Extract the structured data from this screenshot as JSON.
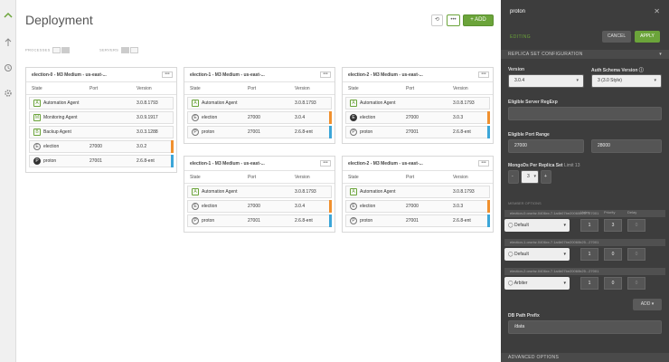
{
  "rail": {
    "items": [
      "deployment-icon",
      "server-icon",
      "clock-icon",
      "gear-icon"
    ]
  },
  "main": {
    "title": "Deployment",
    "add_label": "+ ADD",
    "processes_label": "PROCESSES",
    "servers_label": "SERVERS",
    "columns": [
      "State",
      "Port",
      "Version"
    ],
    "cards": [
      {
        "header": "election-0 - M3 Medium - us-east-...",
        "menu": "•••",
        "rows": [
          {
            "icon": "A",
            "icon_style": "green",
            "name": "Automation Agent",
            "port": "",
            "version": "3.0.8.1793",
            "marker": ""
          },
          {
            "icon": "M",
            "icon_style": "green",
            "name": "Monitoring Agent",
            "port": "",
            "version": "3.0.9.1917",
            "marker": ""
          },
          {
            "icon": "B",
            "icon_style": "green",
            "name": "Backup Agent",
            "port": "",
            "version": "3.0.3.1288",
            "marker": ""
          },
          {
            "icon": "E",
            "icon_style": "",
            "name": "election",
            "port": "27000",
            "version": "3.0.2",
            "marker": "#f0902e"
          },
          {
            "icon": "P",
            "icon_style": "dark",
            "name": "proton",
            "port": "27001",
            "version": "2.6.8-ent",
            "marker": "#3ca6d8"
          }
        ]
      },
      {
        "header": "election-1 - M3 Medium - us-east-...",
        "menu": "•••",
        "rows": [
          {
            "icon": "A",
            "icon_style": "green",
            "name": "Automation Agent",
            "port": "",
            "version": "3.0.8.1793",
            "marker": ""
          },
          {
            "icon": "E",
            "icon_style": "",
            "name": "election",
            "port": "27000",
            "version": "3.0.4",
            "marker": "#f0902e"
          },
          {
            "icon": "P",
            "icon_style": "",
            "name": "proton",
            "port": "27001",
            "version": "2.6.8-ent",
            "marker": "#3ca6d8"
          }
        ]
      },
      {
        "header": "election-2 - M3 Medium - us-east-...",
        "menu": "•••",
        "rows": [
          {
            "icon": "A",
            "icon_style": "green",
            "name": "Automation Agent",
            "port": "",
            "version": "3.0.8.1793",
            "marker": ""
          },
          {
            "icon": "E",
            "icon_style": "dark",
            "name": "election",
            "port": "27000",
            "version": "3.0.3",
            "marker": "#f0902e"
          },
          {
            "icon": "P",
            "icon_style": "",
            "name": "proton",
            "port": "27001",
            "version": "2.6.8-ent",
            "marker": "#3ca6d8"
          }
        ]
      },
      {
        "header": "election-1 - M3 Medium - us-east-...",
        "menu": "•••",
        "rows": [
          {
            "icon": "A",
            "icon_style": "green",
            "name": "Automation Agent",
            "port": "",
            "version": "3.0.8.1793",
            "marker": ""
          },
          {
            "icon": "E",
            "icon_style": "",
            "name": "election",
            "port": "27000",
            "version": "3.0.4",
            "marker": "#f0902e"
          },
          {
            "icon": "P",
            "icon_style": "",
            "name": "proton",
            "port": "27001",
            "version": "2.6.8-ent",
            "marker": "#3ca6d8"
          }
        ]
      },
      {
        "header": "election-2 - M3 Medium - us-east-...",
        "menu": "•••",
        "rows": [
          {
            "icon": "A",
            "icon_style": "green",
            "name": "Automation Agent",
            "port": "",
            "version": "3.0.8.1793",
            "marker": ""
          },
          {
            "icon": "E",
            "icon_style": "",
            "name": "election",
            "port": "27000",
            "version": "3.0.3",
            "marker": "#f0902e"
          },
          {
            "icon": "P",
            "icon_style": "",
            "name": "proton",
            "port": "27001",
            "version": "2.6.8-ent",
            "marker": "#3ca6d8"
          }
        ]
      }
    ]
  },
  "panel": {
    "title": "proton",
    "close": "✕",
    "editing": "EDITING",
    "cancel_label": "CANCEL",
    "apply_label": "APPLY",
    "replica_section": "REPLICA SET CONFIGURATION",
    "version_label": "Version",
    "version_value": "3.0.4",
    "auth_label": "Auth Schema Version",
    "auth_value": "3 (3.0 Style)",
    "regexp_label": "Eligible Server RegExp",
    "regexp_value": "",
    "port_range_label": "Eligible Port Range",
    "port_from": "27000",
    "port_to": "28000",
    "mongods_label": "MongoDs Per Replica Set",
    "mongods_limit": "Limit 13",
    "mongods_value": "3",
    "votes_label": "Votes",
    "priority_label": "Priority",
    "delay_label": "Delay",
    "members": [
      {
        "name": "election-0.ororbz.0406xx.7.1a4b07be20060b25...27001",
        "type": "Default",
        "votes": "1",
        "priority": "3",
        "delay": "0"
      },
      {
        "name": "election-1.ororbz.0406xx.7.1a4b07be20060b25...27001",
        "type": "Default",
        "votes": "1",
        "priority": "0",
        "delay": "0"
      },
      {
        "name": "election-2.ororbz.0406xx.7.1a4b07be20060b25...27001",
        "type": "Arbiter",
        "votes": "1",
        "priority": "0",
        "delay": "0"
      }
    ],
    "members_label": "MEMBER OPTIONS",
    "add_label": "ADD",
    "db_path_label": "DB Path Prefix",
    "db_path_value": "/data",
    "advanced_section": "ADVANCED OPTIONS"
  },
  "colors": {
    "accent": "#6ba43a",
    "orange": "#f0902e",
    "blue": "#3ca6d8",
    "panel_bg": "#3d3d3d"
  }
}
